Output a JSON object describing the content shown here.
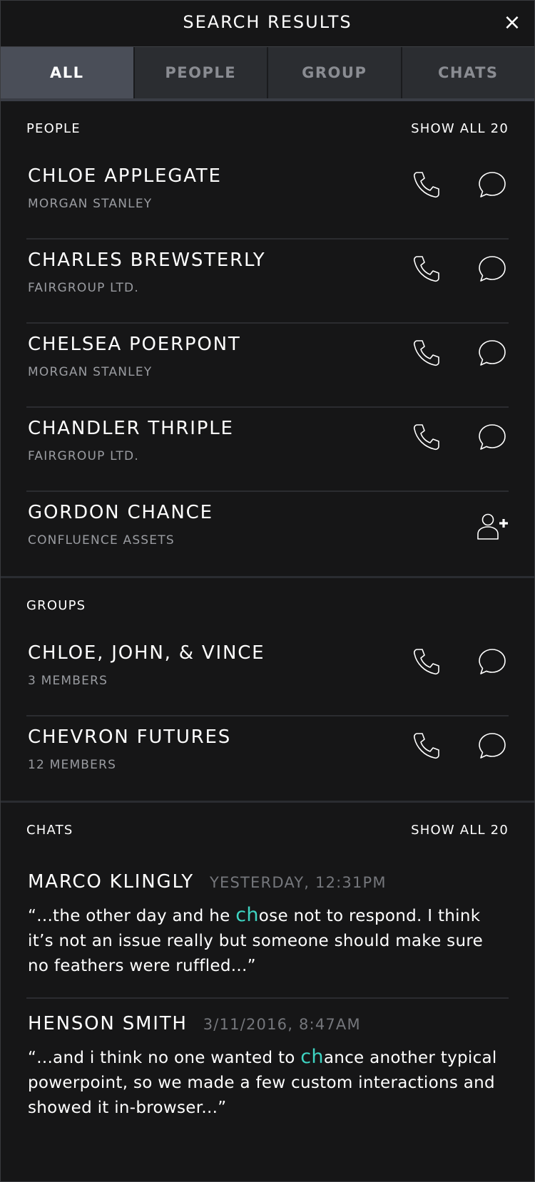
{
  "header": {
    "title": "SEARCH RESULTS",
    "close_icon": "close-icon"
  },
  "tabs": [
    {
      "label": "ALL",
      "active": true
    },
    {
      "label": "PEOPLE",
      "active": false
    },
    {
      "label": "GROUP",
      "active": false
    },
    {
      "label": "CHATS",
      "active": false
    }
  ],
  "people": {
    "heading": "PEOPLE",
    "show_all": "SHOW ALL 20",
    "items": [
      {
        "name": "CHLOE APPLEGATE",
        "org": "MORGAN STANLEY"
      },
      {
        "name": "CHARLES BREWSTERLY",
        "org": "FAIRGROUP LTD."
      },
      {
        "name": "CHELSEA POERPONT",
        "org": "MORGAN STANLEY"
      },
      {
        "name": "CHANDLER THRIPLE",
        "org": "FAIRGROUP LTD."
      },
      {
        "name": "GORDON CHANCE",
        "org": "CONFLUENCE ASSETS"
      }
    ]
  },
  "groups": {
    "heading": "GROUPS",
    "items": [
      {
        "name": "CHLOE, JOHN, & VINCE",
        "members": "3 MEMBERS"
      },
      {
        "name": "CHEVRON FUTURES",
        "members": "12 MEMBERS"
      }
    ]
  },
  "chats": {
    "heading": "CHATS",
    "show_all": "SHOW ALL 20",
    "items": [
      {
        "name": "MARCO KLINGLY",
        "time": "YESTERDAY, 12:31PM",
        "before": "“...the other day and he ",
        "highlight": "ch",
        "after_hl": "ose",
        "rest": " not to respond. I think it’s not an issue really but someone should make sure no feathers were ruffled...”"
      },
      {
        "name": "HENSON SMITH",
        "time": "3/11/2016, 8:47AM",
        "before": "“...and i think no one wanted to ",
        "highlight": "ch",
        "after_hl": "ance",
        "rest": " another typical powerpoint, so we made a few custom interactions and showed it in-browser...”"
      }
    ]
  },
  "colors": {
    "highlight": "#3ed4c2",
    "active_tab": "#4a4e58",
    "background": "#161617"
  }
}
